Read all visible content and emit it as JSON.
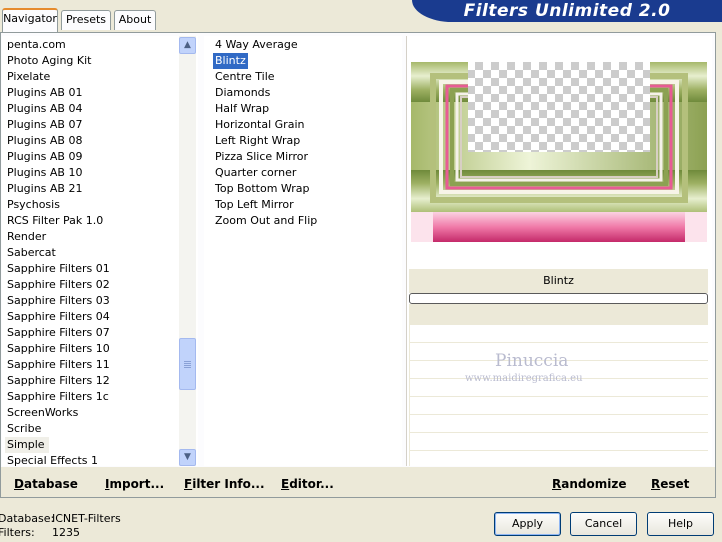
{
  "tabs": [
    {
      "label": "Navigator"
    },
    {
      "label": "Presets"
    },
    {
      "label": "About"
    }
  ],
  "app_title": "Filters Unlimited 2.0",
  "categories": [
    "penta.com",
    "Photo Aging Kit",
    "Pixelate",
    "Plugins AB 01",
    "Plugins AB 04",
    "Plugins AB 07",
    "Plugins AB 08",
    "Plugins AB 09",
    "Plugins AB 10",
    "Plugins AB 21",
    "Psychosis",
    "RCS Filter Pak 1.0",
    "Render",
    "Sabercat",
    "Sapphire Filters 01",
    "Sapphire Filters 02",
    "Sapphire Filters 03",
    "Sapphire Filters 04",
    "Sapphire Filters 07",
    "Sapphire Filters 10",
    "Sapphire Filters 11",
    "Sapphire Filters 12",
    "Sapphire Filters 1c",
    "ScreenWorks",
    "Scribe",
    "Simple",
    "Special Effects 1"
  ],
  "selected_category": "Simple",
  "filters": [
    "4 Way Average",
    "Blintz",
    "Centre Tile",
    "Diamonds",
    "Half Wrap",
    "Horizontal Grain",
    "Left Right Wrap",
    "Pizza Slice Mirror",
    "Quarter corner",
    "Top Bottom Wrap",
    "Top Left Mirror",
    "Zoom Out and Flip"
  ],
  "selected_filter": "Blintz",
  "preview": {
    "filter_name": "Blintz",
    "watermark_name": "Pinuccia",
    "watermark_url": "www.maidiregrafica.eu"
  },
  "actions": {
    "database": "Database",
    "import": "Import...",
    "filter_info": "Filter Info...",
    "editor": "Editor...",
    "randomize": "Randomize",
    "reset": "Reset"
  },
  "status": {
    "database_label": "Database:",
    "database_value": "ICNET-Filters",
    "filters_label": "Filters:",
    "filters_value": "1235"
  },
  "buttons": {
    "apply": "Apply",
    "cancel": "Cancel",
    "help": "Help"
  },
  "icons": {
    "scroll_up": "scroll-up-icon",
    "scroll_down": "scroll-down-icon"
  },
  "colors": {
    "selection": "#316ac5",
    "banner": "#1a3b8f",
    "tab_accent": "#e68b2c"
  }
}
